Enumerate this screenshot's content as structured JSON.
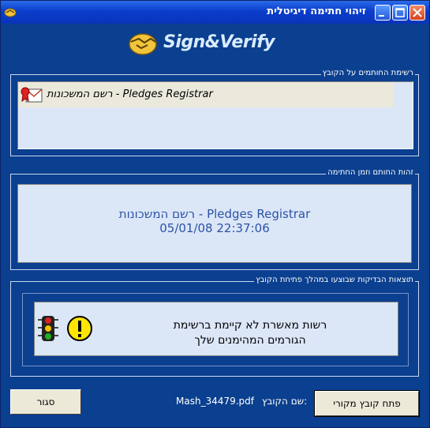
{
  "window": {
    "title": "זיהוי חתימה דיגיטלית",
    "controls": [
      "minimize",
      "maximize",
      "close"
    ]
  },
  "brand": {
    "name": "Sign&Verify",
    "logo_icon": "handshake-icon"
  },
  "signers": {
    "caption": "רשימת החותמים על הקובץ",
    "items": [
      {
        "label": "רשם המשכונות - Pledges Registrar",
        "icon": "certificate-icon"
      }
    ]
  },
  "identity": {
    "caption": "זהות החותם וזמן החתימה",
    "name": "רשם המשכונות - Pledges Registrar",
    "datetime": "05/01/08 22:37:06"
  },
  "results": {
    "caption": "תוצאות הבדיקות שבוצעו במהלך פתיחת הקובץ",
    "line1": "רשות מאשרת לא קיימת ברשימת",
    "line2": "הגורמים המהימנים שלך",
    "icons": [
      "traffic-light-icon",
      "warning-icon"
    ]
  },
  "footer": {
    "close_label": "סגור",
    "filename_label": "שם הקובץ:",
    "filename": "Mash_34479.pdf",
    "open_label": "פתח קובץ מקורי"
  },
  "colors": {
    "window_bg": "#0b3f8f",
    "panel_bg": "#dbe6f7",
    "identity_text": "#2b53a6",
    "button_bg": "#ece9d8"
  }
}
